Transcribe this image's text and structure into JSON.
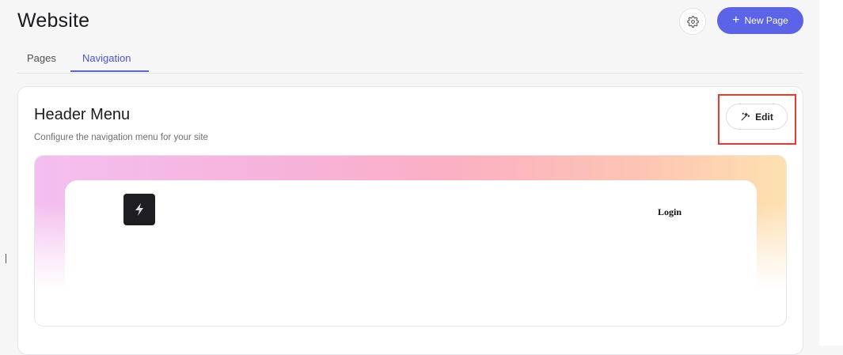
{
  "page": {
    "title": "Website",
    "new_page_label": "New Page",
    "accent_color": "#5b63e6"
  },
  "icons": {
    "settings": "gear-icon",
    "add": "plus-icon",
    "edit": "magic-wand-icon",
    "logo": "lightning-bolt-icon"
  },
  "tabs": [
    {
      "label": "Pages",
      "active": false
    },
    {
      "label": "Navigation",
      "active": true
    }
  ],
  "card": {
    "title": "Header Menu",
    "subtitle": "Configure the navigation menu for your site",
    "edit_label": "Edit"
  },
  "preview": {
    "login_label": "Login"
  }
}
